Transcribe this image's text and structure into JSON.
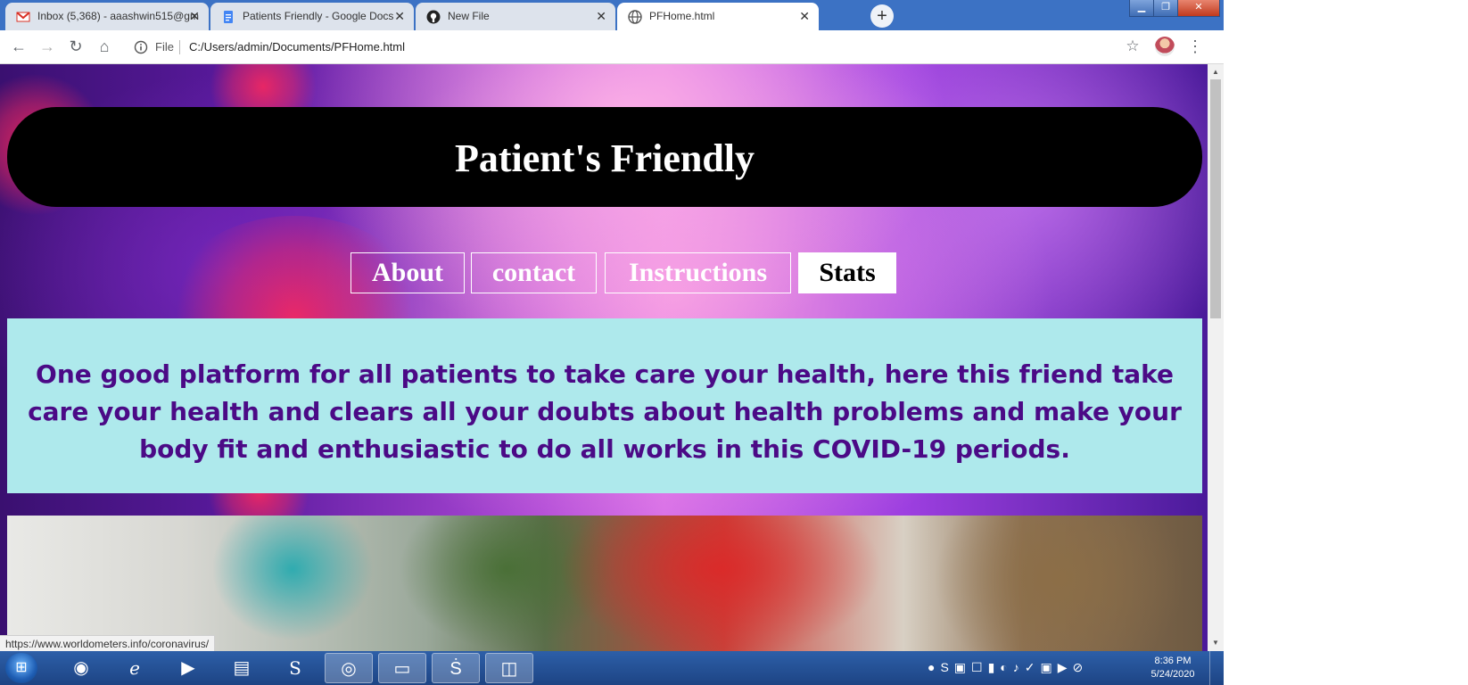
{
  "tabs": [
    {
      "title": "Inbox (5,368) - aaashwin515@gm",
      "icon": "gmail-icon",
      "active": false
    },
    {
      "title": "Patients Friendly - Google Docs",
      "icon": "docs-icon",
      "active": false
    },
    {
      "title": "New File",
      "icon": "github-icon",
      "active": false
    },
    {
      "title": "PFHome.html",
      "icon": "globe-icon",
      "active": true
    }
  ],
  "toolbar": {
    "file_label": "File",
    "url": "C:/Users/admin/Documents/PFHome.html"
  },
  "page": {
    "title": "Patient's Friendly",
    "nav": [
      {
        "label": "About"
      },
      {
        "label": "contact"
      },
      {
        "label": "Instructions"
      },
      {
        "label": "Stats"
      }
    ],
    "intro": "One good platform for all patients to take care your health, here this friend take care your health and clears all your doubts about health problems and make your body fit and enthusiastic to do all works in this COVID-19 periods."
  },
  "status_url": "https://www.worldometers.info/coronavirus/",
  "taskbar": {
    "time": "8:36 PM",
    "date": "5/24/2020"
  }
}
